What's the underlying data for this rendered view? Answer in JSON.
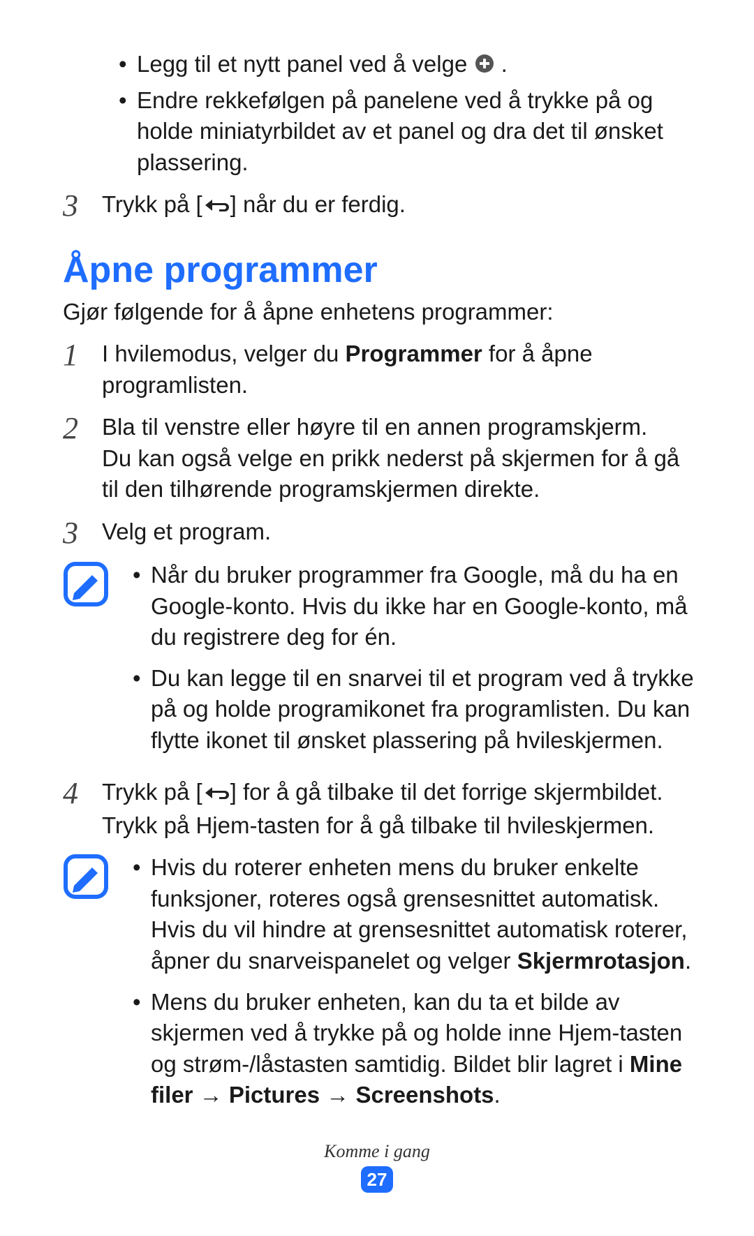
{
  "top_bullets": [
    {
      "pre": "Legg til et nytt panel ved å velge ",
      "icon": "plus-circle",
      "post": "."
    },
    {
      "text": "Endre rekkefølgen på panelene ved å trykke på og holde miniatyrbildet av et panel og dra det til ønsket plassering."
    }
  ],
  "top_step3": {
    "num": "3",
    "pre": "Trykk på [",
    "icon": "back",
    "post": "] når du er ferdig."
  },
  "section_title": "Åpne programmer",
  "intro": "Gjør følgende for å åpne enhetens programmer:",
  "step1": {
    "num": "1",
    "pre": "I hvilemodus, velger du ",
    "bold": "Programmer",
    "post": " for å åpne programlisten."
  },
  "step2": {
    "num": "2",
    "line1": "Bla til venstre eller høyre til en annen programskjerm.",
    "line2": "Du kan også velge en prikk nederst på skjermen for å gå til den tilhørende programskjermen direkte."
  },
  "step3b": {
    "num": "3",
    "text": "Velg et program."
  },
  "note1": [
    "Når du bruker programmer fra Google, må du ha en Google-konto. Hvis du ikke har en Google-konto, må du registrere deg for én.",
    "Du kan legge til en snarvei til et program ved å trykke på og holde programikonet fra programlisten. Du kan flytte ikonet til ønsket plassering på hvileskjermen."
  ],
  "step4": {
    "num": "4",
    "pre": "Trykk på [",
    "icon": "back",
    "mid": "] for å gå tilbake til det forrige skjermbildet. Trykk på Hjem-tasten for å gå tilbake til hvileskjermen."
  },
  "note2": [
    {
      "pre": "Hvis du roterer enheten mens du bruker enkelte funksjoner, roteres også grensesnittet automatisk. Hvis du vil hindre at grensesnittet automatisk roterer, åpner du snarveispanelet og velger ",
      "bold": "Skjermrotasjon",
      "post": "."
    },
    {
      "pre": "Mens du bruker enheten, kan du ta et bilde av skjermen ved å trykke på og holde inne Hjem-tasten og strøm-/låstasten samtidig. Bildet blir lagret i ",
      "bold1": "Mine filer",
      "arrow1": " → ",
      "bold2": "Pictures",
      "arrow2": " → ",
      "bold3": "Screenshots",
      "post": "."
    }
  ],
  "footer_text": "Komme i gang",
  "page_number": "27"
}
